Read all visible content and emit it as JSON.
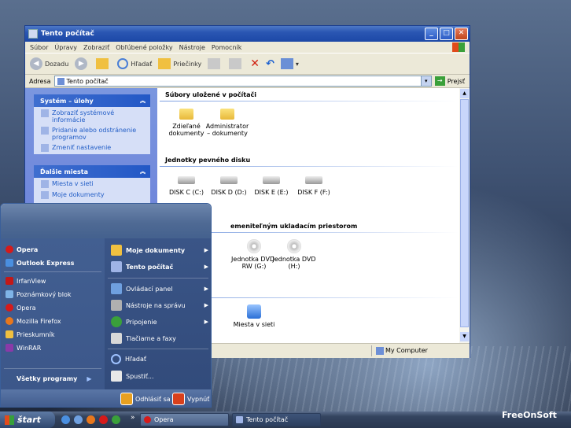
{
  "window": {
    "title": "Tento počítač",
    "menu": [
      "Súbor",
      "Úpravy",
      "Zobraziť",
      "Obľúbené položky",
      "Nástroje",
      "Pomocník"
    ],
    "toolbar": {
      "back": "Dozadu",
      "search": "Hľadať",
      "folders": "Priečinky"
    },
    "address_label": "Adresa",
    "address_value": "Tento počítač",
    "go_label": "Prejsť",
    "status": "My Computer"
  },
  "tasks": {
    "system_header": "Systém – úlohy",
    "system_items": [
      "Zobraziť systémové informácie",
      "Pridanie alebo odstránenie programov",
      "Zmeniť nastavenie"
    ],
    "places_header": "Ďalšie miesta",
    "places_items": [
      "Miesta v sieti",
      "Moje dokumenty"
    ]
  },
  "content": {
    "group_files": "Súbory uložené v počítači",
    "files": [
      "Zdieľané dokumenty",
      "Administrator – dokumenty"
    ],
    "group_disks": "Jednotky pevného disku",
    "disks": [
      "DISK C (C:)",
      "DISK D (D:)",
      "DISK E (E:)",
      "DISK F (F:)"
    ],
    "group_removable": "emeniteľným ukladacím priestorom",
    "removable": [
      "Jednotka DVD-RW (G:)",
      "Jednotka DVD (H:)"
    ],
    "network": "Miesta v sieti"
  },
  "startmenu": {
    "pinned": [
      "Opera",
      "Outlook Express"
    ],
    "recent": [
      "IrfanView",
      "Poznámkový blok",
      "Opera",
      "Mozilla Firefox",
      "Prieskumník",
      "WinRAR"
    ],
    "all_programs": "Všetky programy",
    "right": [
      "Moje dokumenty",
      "Tento počítač",
      "Ovládací panel",
      "Nástroje na správu",
      "Pripojenie",
      "Tlačiarne a faxy",
      "Hľadať",
      "Spustiť..."
    ],
    "logoff": "Odhlásiť sa",
    "shutdown": "Vypnúť"
  },
  "taskbar": {
    "start": "štart",
    "tasks": [
      "Opera",
      "Tento počítač"
    ]
  },
  "watermark": "FreeOnSoft",
  "colors": {
    "xp_blue": "#2a56b3",
    "taskbar": "#34445f",
    "start_menu_left": "#425f91"
  }
}
